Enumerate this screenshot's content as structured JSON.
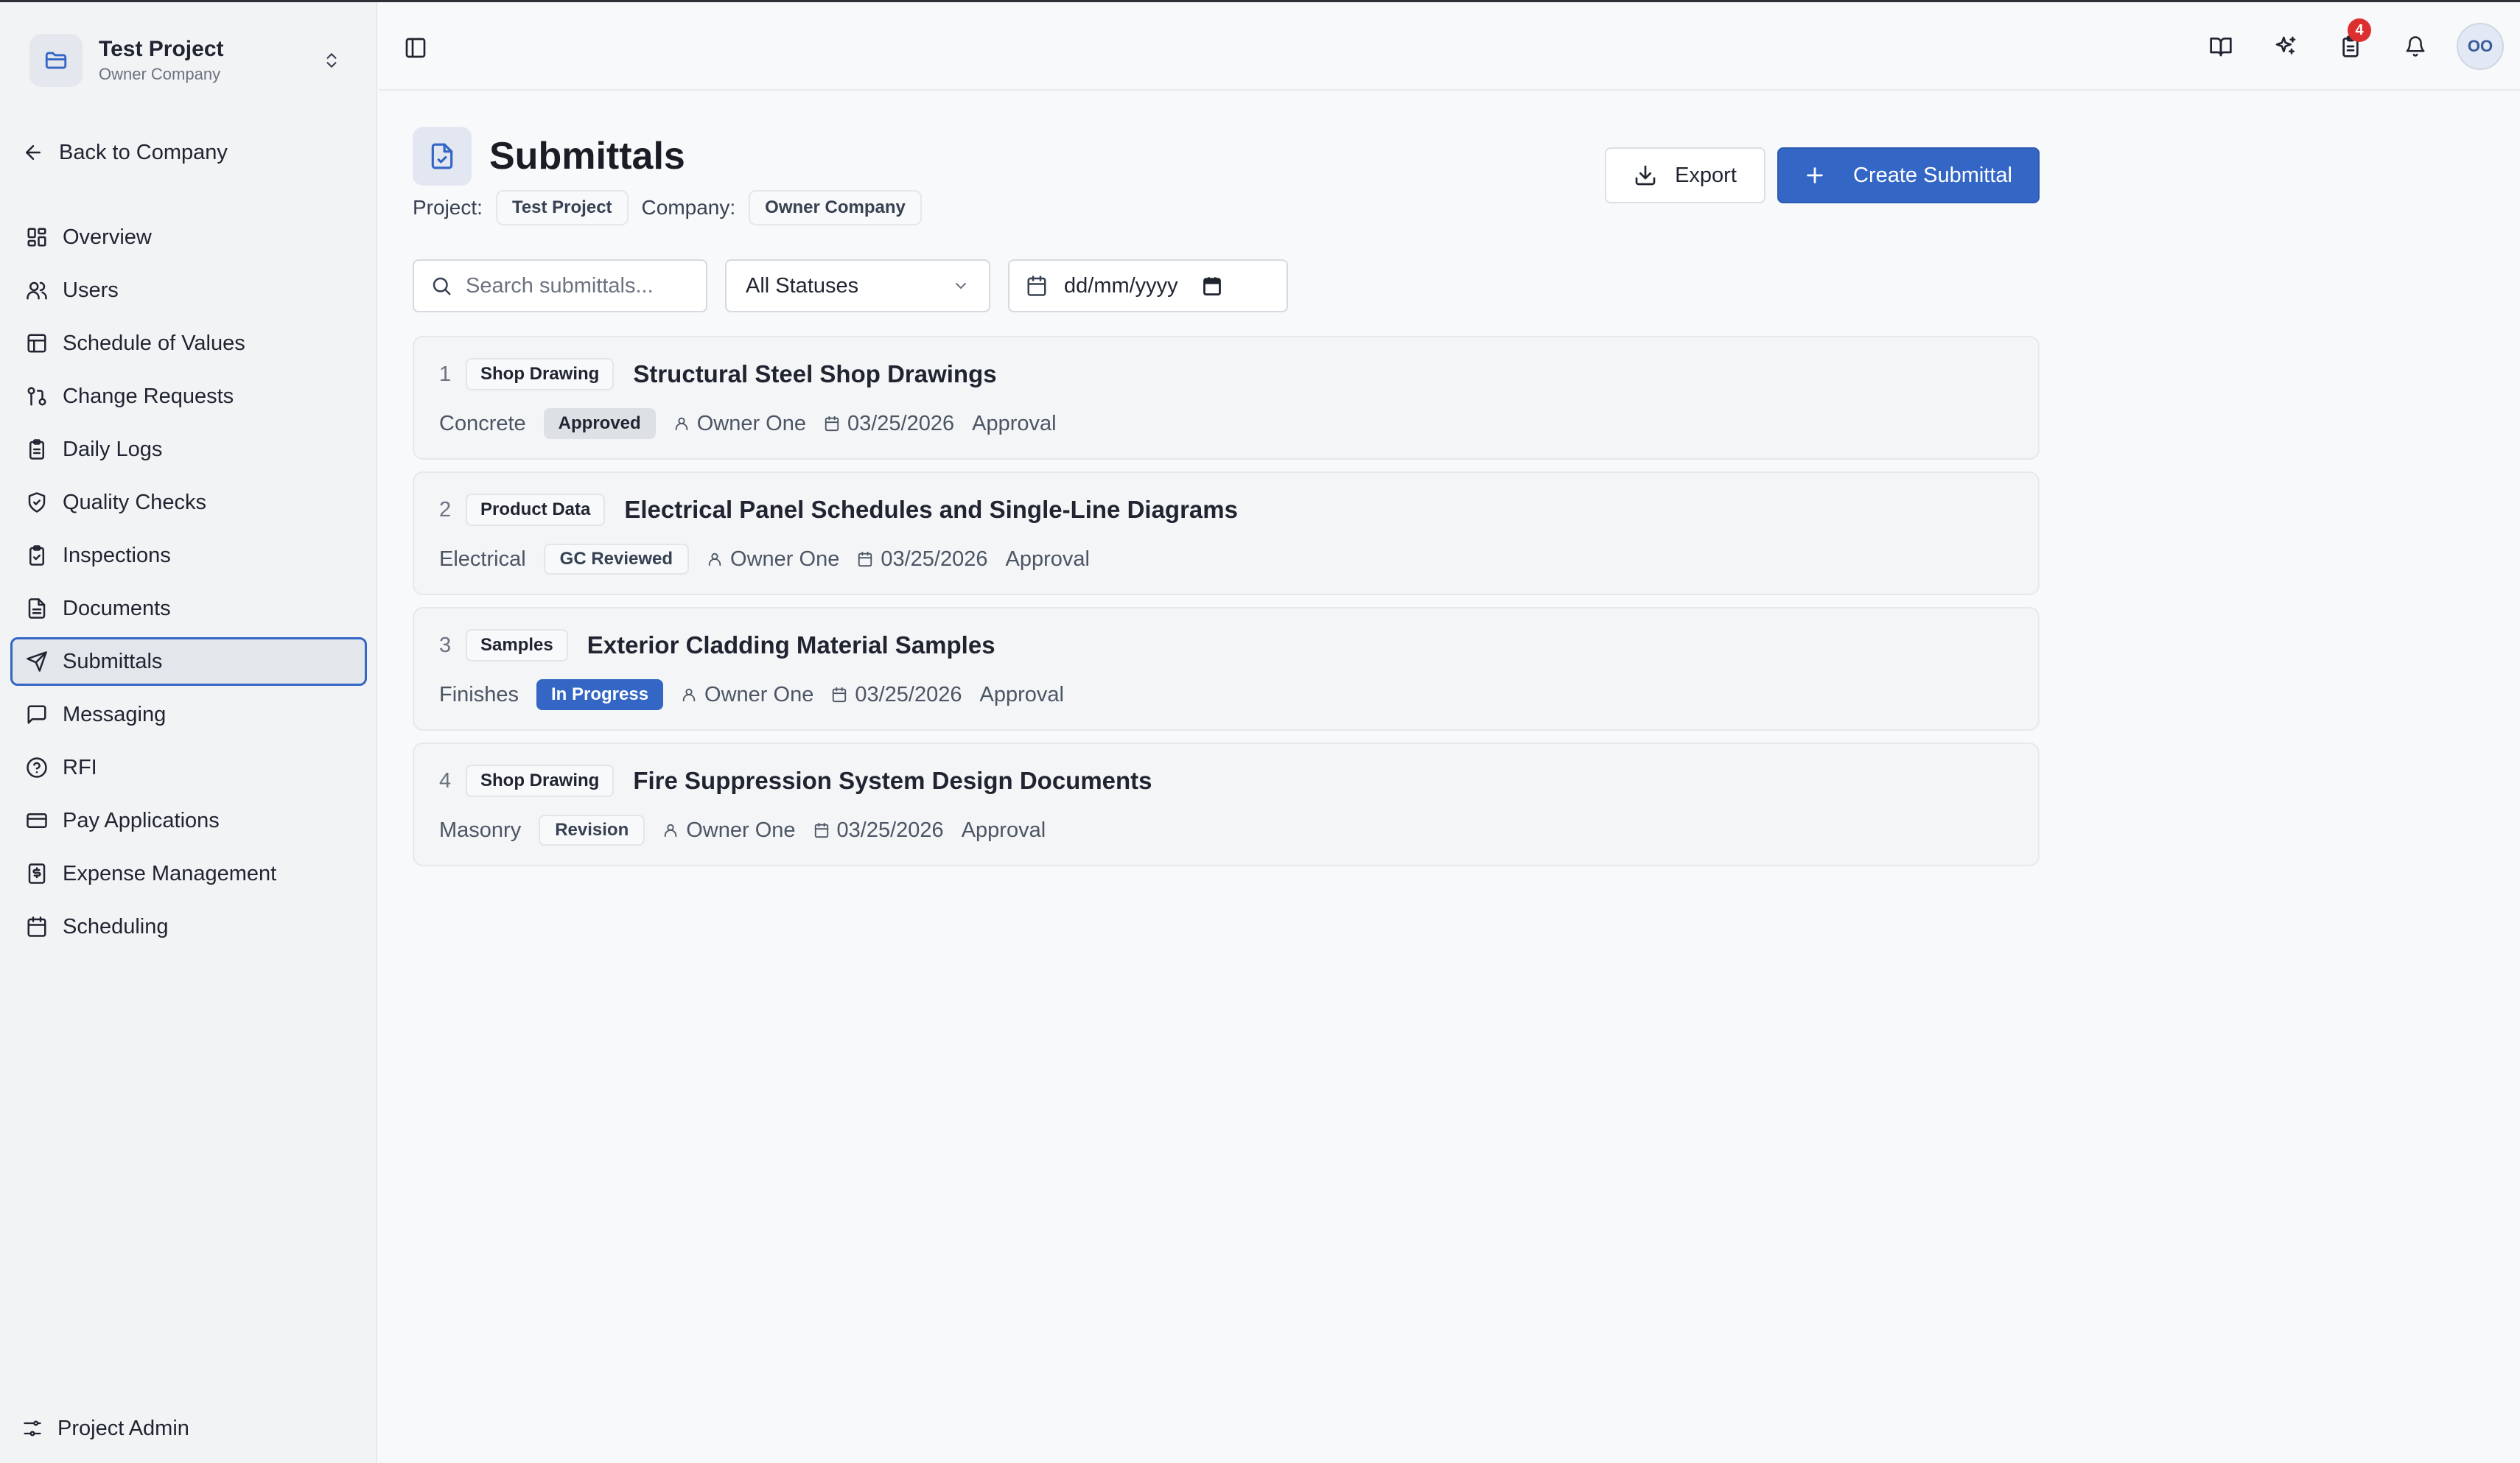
{
  "project_switcher": {
    "name": "Test Project",
    "company": "Owner Company"
  },
  "back_label": "Back to Company",
  "nav": {
    "items": [
      {
        "label": "Overview",
        "icon": "dashboard-icon"
      },
      {
        "label": "Users",
        "icon": "users-icon"
      },
      {
        "label": "Schedule of Values",
        "icon": "table-icon"
      },
      {
        "label": "Change Requests",
        "icon": "git-pull-request-icon"
      },
      {
        "label": "Daily Logs",
        "icon": "clipboard-icon"
      },
      {
        "label": "Quality Checks",
        "icon": "shield-check-icon"
      },
      {
        "label": "Inspections",
        "icon": "clipboard-check-icon"
      },
      {
        "label": "Documents",
        "icon": "file-text-icon"
      },
      {
        "label": "Submittals",
        "icon": "send-icon",
        "active": true
      },
      {
        "label": "Messaging",
        "icon": "message-square-icon"
      },
      {
        "label": "RFI",
        "icon": "help-circle-icon"
      },
      {
        "label": "Pay Applications",
        "icon": "credit-card-icon"
      },
      {
        "label": "Expense Management",
        "icon": "receipt-icon"
      },
      {
        "label": "Scheduling",
        "icon": "calendar-icon"
      }
    ]
  },
  "admin_label": "Project Admin",
  "header": {
    "notification_count": "4",
    "avatar_initials": "OO"
  },
  "page": {
    "title": "Submittals",
    "project_label": "Project:",
    "project_value": "Test Project",
    "company_label": "Company:",
    "company_value": "Owner Company",
    "export_label": "Export",
    "create_label": "Create Submittal"
  },
  "filters": {
    "search_placeholder": "Search submittals...",
    "status_value": "All Statuses",
    "date_placeholder": "dd/mm/yyyy"
  },
  "submittals": [
    {
      "number": "1",
      "type": "Shop Drawing",
      "title": "Structural Steel Shop Drawings",
      "category": "Concrete",
      "status": "Approved",
      "owner": "Owner One",
      "date": "03/25/2026",
      "action": "Approval"
    },
    {
      "number": "2",
      "type": "Product Data",
      "title": "Electrical Panel Schedules and Single-Line Diagrams",
      "category": "Electrical",
      "status": "GC Reviewed",
      "owner": "Owner One",
      "date": "03/25/2026",
      "action": "Approval"
    },
    {
      "number": "3",
      "type": "Samples",
      "title": "Exterior Cladding Material Samples",
      "category": "Finishes",
      "status": "In Progress",
      "owner": "Owner One",
      "date": "03/25/2026",
      "action": "Approval"
    },
    {
      "number": "4",
      "type": "Shop Drawing",
      "title": "Fire Suppression System Design Documents",
      "category": "Masonry",
      "status": "Revision",
      "owner": "Owner One",
      "date": "03/25/2026",
      "action": "Approval"
    }
  ],
  "colors": {
    "accent": "#3366c5",
    "approved_bg": "#dde0e5",
    "in_progress_bg": "#3366c5",
    "notification": "#dc3030"
  }
}
